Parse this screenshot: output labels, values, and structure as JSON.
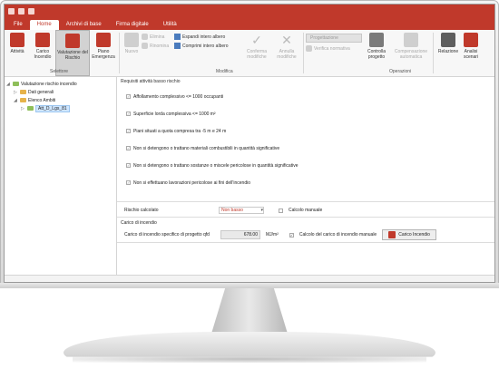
{
  "tabs": [
    "File",
    "Home",
    "Archivi di base",
    "Firma digitale",
    "Utilità"
  ],
  "active_tab": "Home",
  "ribbon": {
    "buttons_left": [
      {
        "label": "Attività",
        "icon": "activity-icon"
      },
      {
        "label": "Carico Incendio",
        "icon": "fire-load-icon"
      },
      {
        "label": "Valutazione del Rischio",
        "icon": "risk-assessment-icon"
      },
      {
        "label": "Piano Emergenza",
        "icon": "emergency-plan-icon"
      }
    ],
    "group_selettore": "Selettore",
    "nuovo": "Nuovo",
    "elimina": "Elimina",
    "rinomina": "Rinomina",
    "espandi": "Espandi intero albero",
    "comprimi": "Comprimi intero albero",
    "conferma": "Conferma modifiche",
    "annulla": "Annulla modifiche",
    "group_modifica": "Modifica",
    "progettazione": "Progettazione",
    "verifica": "Verifica normativa",
    "controlla": "Controlla progetto",
    "compensazione": "Compensazione automatica",
    "relazione": "Relazione",
    "analisi": "Analisi scenari",
    "group_operazioni": "Operazioni"
  },
  "tree": {
    "root": "Valutazione rischio incendio",
    "dati": "Dati generali",
    "elenco": "Elenco Ambiti",
    "item": "Att_D_Lgs_81"
  },
  "content": {
    "section_title": "Requisiti attività basso rischio",
    "requirements": [
      "Affollamento complessivo <= 1000 occupanti",
      "Superficie lorda complessiva <= 1000 m²",
      "Piani situati a quota compresa tra -5 m e 24 m",
      "Non si detengono o trattano materiali combustibili in quantità significative",
      "Non si detengono o trattano sostanze o miscele pericolose in quantità significative",
      "Non si effettuano lavorazioni pericolose ai fini dell'incendio"
    ],
    "rischio_label": "Rischio calcolato",
    "rischio_value": "Non basso",
    "calcolo_manuale": "Calcolo manuale",
    "carico_title": "Carico di incendio",
    "carico_label": "Carico di incendio specifico di progetto qfd",
    "carico_value": "678.00",
    "carico_unit": "MJ/m²",
    "calcolo_carico_manuale": "Calcolo del carico di incendio manuale",
    "carico_btn": "Carico Incendio"
  },
  "colors": {
    "accent": "#c0392b"
  }
}
